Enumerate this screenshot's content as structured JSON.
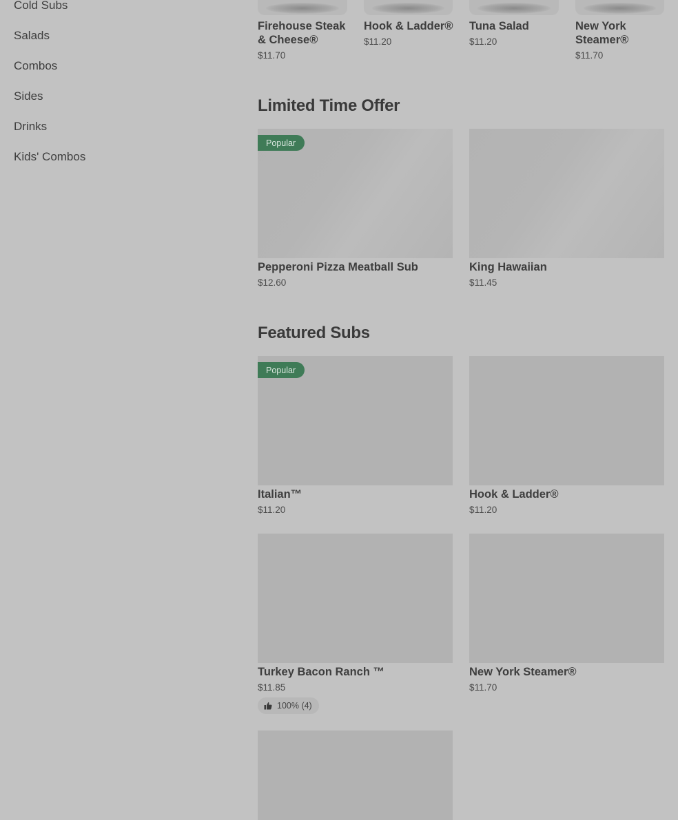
{
  "sidebar": {
    "items": [
      {
        "label": "Cold Subs"
      },
      {
        "label": "Salads"
      },
      {
        "label": "Combos"
      },
      {
        "label": "Sides"
      },
      {
        "label": "Drinks"
      },
      {
        "label": "Kids' Combos"
      }
    ]
  },
  "top_row": {
    "items": [
      {
        "name": "Firehouse Steak & Cheese®",
        "price": "$11.70"
      },
      {
        "name": "Hook & Ladder®",
        "price": "$11.20"
      },
      {
        "name": "Tuna Salad",
        "price": "$11.20"
      },
      {
        "name": "New York Steamer®",
        "price": "$11.70"
      }
    ]
  },
  "limited": {
    "title": "Limited Time Offer",
    "items": [
      {
        "name": "Pepperoni Pizza Meatball Sub",
        "price": "$12.60",
        "badge": "Popular"
      },
      {
        "name": "King Hawaiian",
        "price": "$11.45"
      }
    ]
  },
  "featured": {
    "title": "Featured Subs",
    "items": [
      {
        "name": "Italian™",
        "price": "$11.20",
        "badge": "Popular"
      },
      {
        "name": "Hook & Ladder®",
        "price": "$11.20"
      },
      {
        "name": "Turkey Bacon Ranch ™",
        "price": "$11.85",
        "rating": "100% (4)"
      },
      {
        "name": "New York Steamer®",
        "price": "$11.70"
      }
    ]
  },
  "colors": {
    "background": "#c2c2c2",
    "badge": "#3f7b57"
  },
  "icons": {
    "rating": "thumbs-up-icon"
  }
}
